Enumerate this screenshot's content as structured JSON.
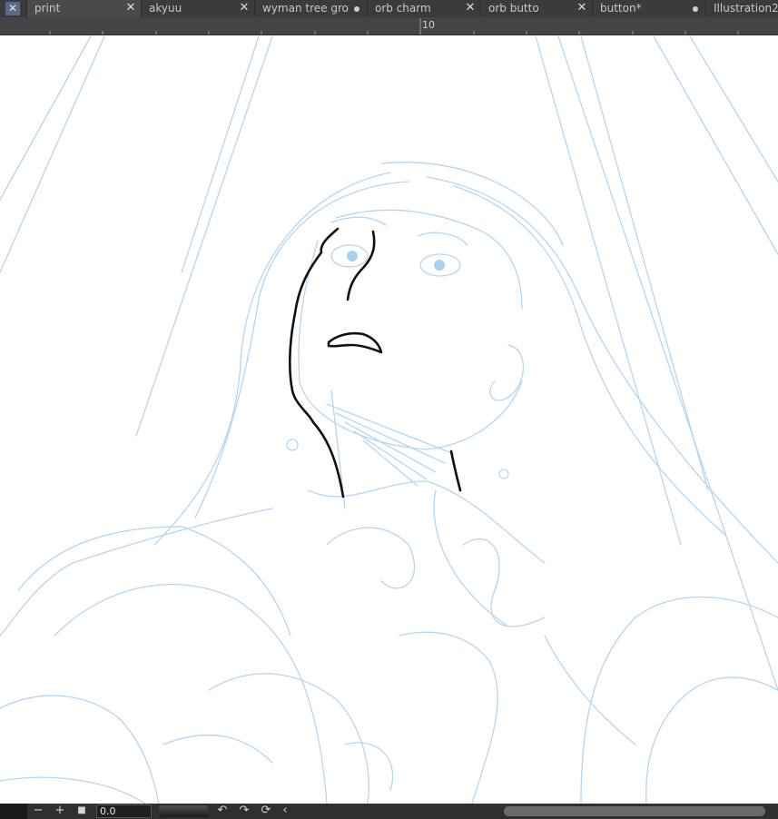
{
  "tabs": [
    {
      "label": "print",
      "closable": true
    },
    {
      "label": "akyuu",
      "closable": true
    },
    {
      "label": "wyman tree gro",
      "closable": false
    },
    {
      "label": "orb charm",
      "closable": true
    },
    {
      "label": "orb butto",
      "closable": true
    },
    {
      "label": "button*",
      "closable": false
    },
    {
      "label": "Illustration2",
      "closable": false
    }
  ],
  "tab_close_glyph": "✕",
  "ruler": {
    "label": "10"
  },
  "statusbar": {
    "minus": "−",
    "plus": "+",
    "stop": "■",
    "zoom_value": "0.0",
    "undo": "↶",
    "redo": "↷",
    "reset": "⟳",
    "chevron": "‹"
  },
  "colors": {
    "sketch_line": "#a8d0f0",
    "ink_line": "#111111",
    "ui_dark": "#3b3b3b"
  },
  "icons": [
    "close-icon",
    "dot-icon",
    "minus-icon",
    "plus-icon",
    "stop-icon",
    "undo-icon",
    "redo-icon",
    "reset-icon",
    "chevron-left-icon"
  ]
}
